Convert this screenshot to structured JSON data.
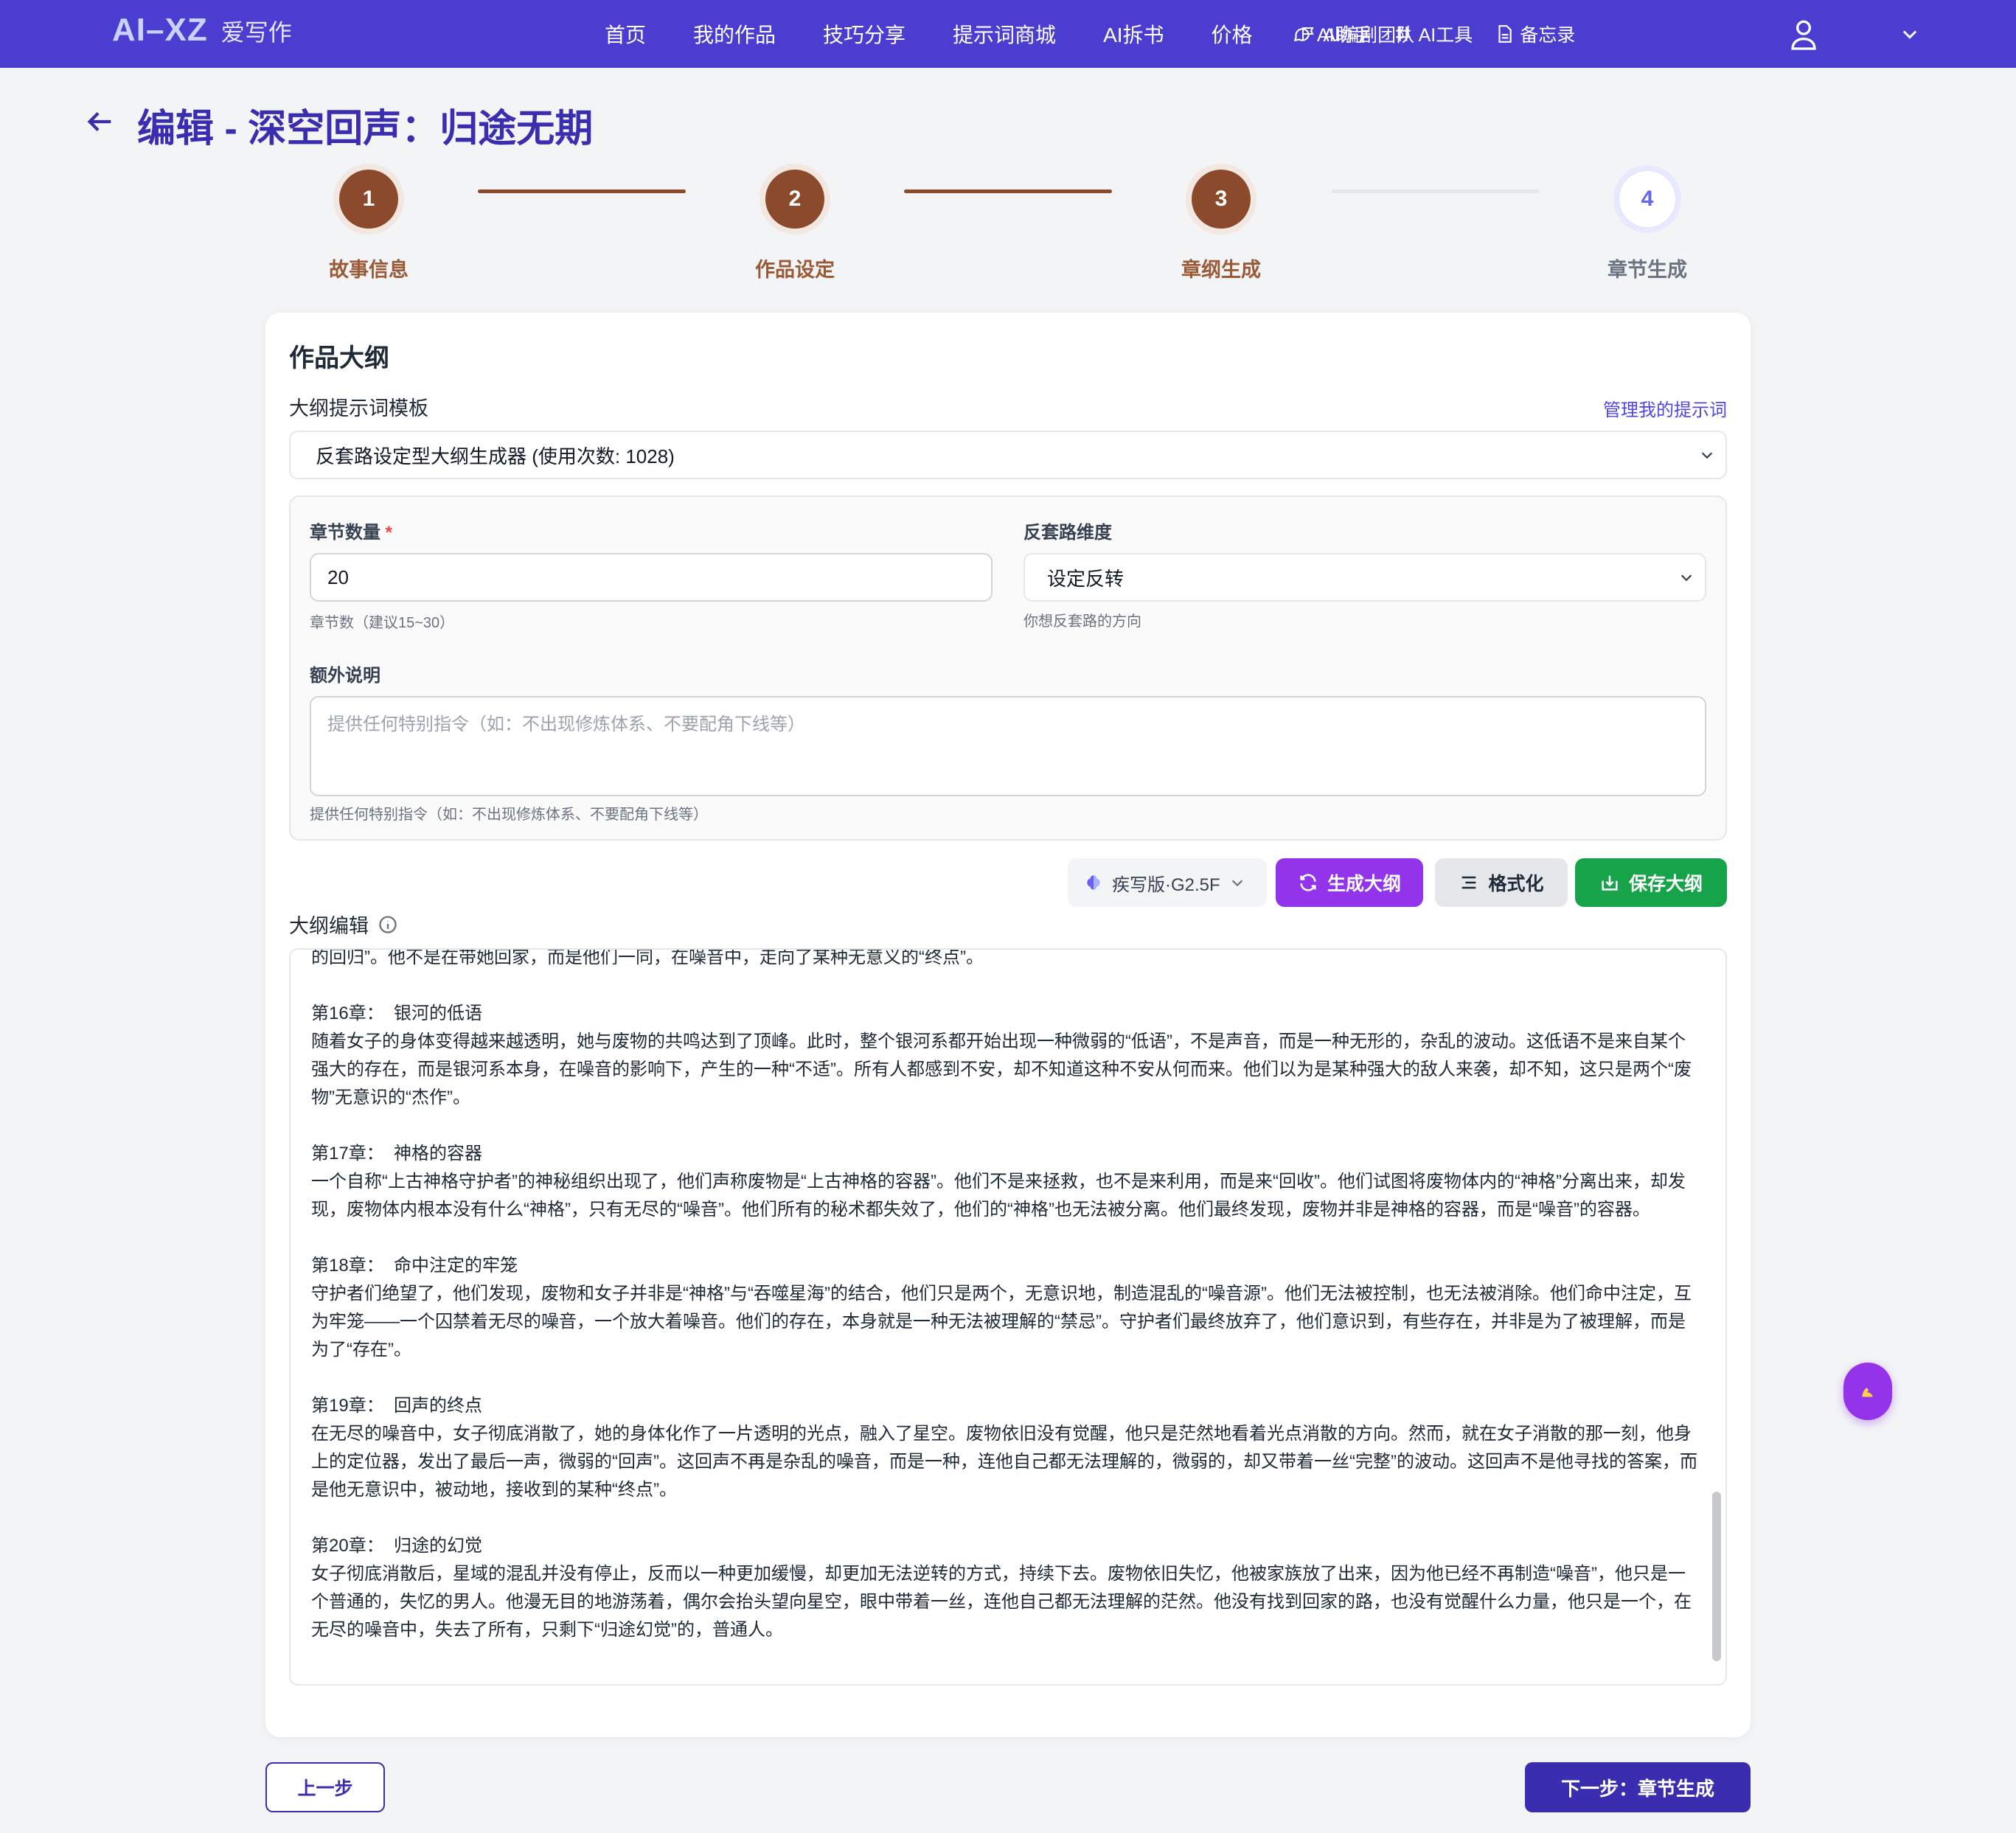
{
  "nav": {
    "logo_text": "AI–XZ",
    "logo_cn": "爱写作",
    "links": [
      "首页",
      "我的作品",
      "技巧分享",
      "提示词商城",
      "AI拆书",
      "价格",
      "AI编剧团队"
    ],
    "tools": [
      "AI助手",
      "AI工具",
      "备忘录"
    ]
  },
  "page": {
    "title": "编辑 - 深空回声：归途无期"
  },
  "steps": [
    {
      "num": "1",
      "label": "故事信息"
    },
    {
      "num": "2",
      "label": "作品设定"
    },
    {
      "num": "3",
      "label": "章纲生成"
    },
    {
      "num": "4",
      "label": "章节生成"
    }
  ],
  "outline": {
    "title": "作品大纲",
    "template_label": "大纲提示词模板",
    "manage_link": "管理我的提示词",
    "template_value": "反套路设定型大纲生成器 (使用次数: 1028)",
    "chapter_count_label": "章节数量",
    "required_mark": "*",
    "chapter_count_value": "20",
    "chapter_count_hint": "章节数（建议15~30）",
    "anti_trope_label": "反套路维度",
    "anti_trope_value": "设定反转",
    "anti_trope_hint": "你想反套路的方向",
    "extra_label": "额外说明",
    "extra_placeholder": "提供任何特别指令（如：不出现修炼体系、不要配角下线等）",
    "extra_hint": "提供任何特别指令（如：不出现修炼体系、不要配角下线等）",
    "model": "疾写版·G2.5F",
    "generate_btn": "生成大纲",
    "format_btn": "格式化",
    "save_btn": "保存大纲",
    "editor_label": "大纲编辑",
    "editor_content": "的回归”。他不是在带她回家，而是他们一同，在噪音中，走向了某种无意义的“终点”。\n\n第16章：  银河的低语\n随着女子的身体变得越来越透明，她与废物的共鸣达到了顶峰。此时，整个银河系都开始出现一种微弱的“低语”，不是声音，而是一种无形的，杂乱的波动。这低语不是来自某个强大的存在，而是银河系本身，在噪音的影响下，产生的一种“不适”。所有人都感到不安，却不知道这种不安从何而来。他们以为是某种强大的敌人来袭，却不知，这只是两个“废物”无意识的“杰作”。\n\n第17章：  神格的容器\n一个自称“上古神格守护者”的神秘组织出现了，他们声称废物是“上古神格的容器”。他们不是来拯救，也不是来利用，而是来“回收”。他们试图将废物体内的“神格”分离出来，却发现，废物体内根本没有什么“神格”，只有无尽的“噪音”。他们所有的秘术都失效了，他们的“神格”也无法被分离。他们最终发现，废物并非是神格的容器，而是“噪音”的容器。\n\n第18章：  命中注定的牢笼\n守护者们绝望了，他们发现，废物和女子并非是“神格”与“吞噬星海”的结合，他们只是两个，无意识地，制造混乱的“噪音源”。他们无法被控制，也无法被消除。他们命中注定，互为牢笼——一个囚禁着无尽的噪音，一个放大着噪音。他们的存在，本身就是一种无法被理解的“禁忌”。守护者们最终放弃了，他们意识到，有些存在，并非是为了被理解，而是为了“存在”。\n\n第19章：  回声的终点\n在无尽的噪音中，女子彻底消散了，她的身体化作了一片透明的光点，融入了星空。废物依旧没有觉醒，他只是茫然地看着光点消散的方向。然而，就在女子消散的那一刻，他身上的定位器，发出了最后一声，微弱的“回声”。这回声不再是杂乱的噪音，而是一种，连他自己都无法理解的，微弱的，却又带着一丝“完整”的波动。这回声不是他寻找的答案，而是他无意识中，被动地，接收到的某种“终点”。\n\n第20章：  归途的幻觉\n女子彻底消散后，星域的混乱并没有停止，反而以一种更加缓慢，却更加无法逆转的方式，持续下去。废物依旧失忆，他被家族放了出来，因为他已经不再制造“噪音”，他只是一个普通的，失忆的男人。他漫无目的地游荡着，偶尔会抬头望向星空，眼中带着一丝，连他自己都无法理解的茫然。他没有找到回家的路，也没有觉醒什么力量，他只是一个，在无尽的噪音中，失去了所有，只剩下“归途幻觉”的，普通人。"
  },
  "footer": {
    "prev_btn": "上一步",
    "next_btn": "下一步：章节生成"
  },
  "colors": {
    "nav_bg": "#4c3dd1",
    "accent": "#3b2db0",
    "step_done": "#8a4a2b",
    "generate": "#9333ea",
    "save": "#16a34a"
  }
}
